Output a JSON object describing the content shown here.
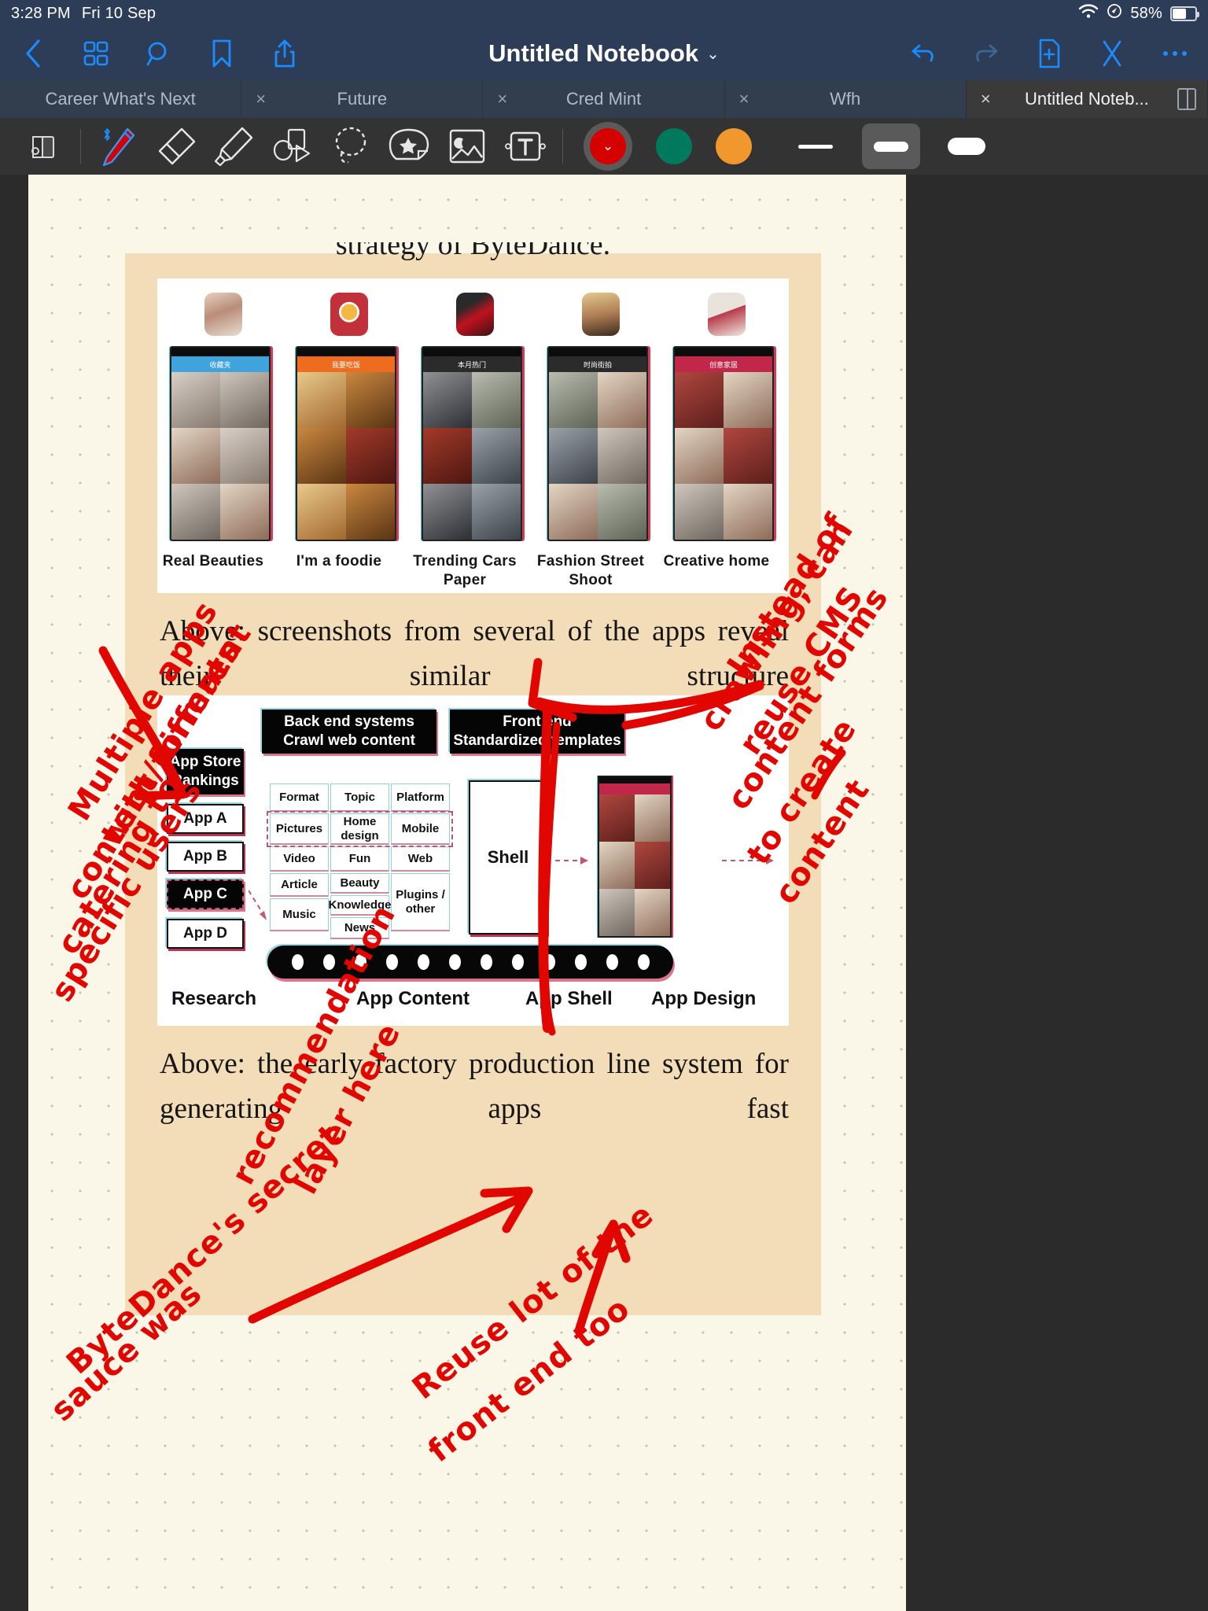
{
  "status_bar": {
    "time": "3:28 PM",
    "date": "Fri 10 Sep",
    "battery_percent": "58%",
    "wifi_icon": "wifi-icon",
    "location_icon": "location-icon"
  },
  "nav_bar": {
    "title": "Untitled Notebook",
    "title_caret": "⌄",
    "left_icons": [
      "back-chevron-icon",
      "grid-view-icon",
      "search-icon",
      "bookmark-icon",
      "share-icon"
    ],
    "right_icons": [
      "undo-icon",
      "redo-icon",
      "add-page-icon",
      "close-icon",
      "more-options-icon"
    ]
  },
  "tabs": [
    {
      "label": "Career What's Next",
      "active": false,
      "close": "×"
    },
    {
      "label": "Future",
      "active": false,
      "close": "×"
    },
    {
      "label": "Cred Mint",
      "active": false,
      "close": "×"
    },
    {
      "label": "Wfh",
      "active": false,
      "close": "×"
    },
    {
      "label": "Untitled Noteb...",
      "active": true,
      "close": "×"
    }
  ],
  "toolbar": {
    "tools": [
      {
        "name": "page-view-icon",
        "label": "Page view"
      },
      {
        "name": "pen-icon",
        "label": "Pen",
        "selected": true,
        "badge": "bluetooth-icon"
      },
      {
        "name": "eraser-icon",
        "label": "Eraser"
      },
      {
        "name": "highlighter-icon",
        "label": "Highlighter"
      },
      {
        "name": "shapes-icon",
        "label": "Shapes"
      },
      {
        "name": "lasso-select-icon",
        "label": "Lasso select"
      },
      {
        "name": "sticker-icon",
        "label": "Sticker"
      },
      {
        "name": "image-icon",
        "label": "Image"
      },
      {
        "name": "text-box-icon",
        "label": "Text box"
      }
    ],
    "colors": [
      {
        "name": "color-red-selected",
        "hex": "#d50000",
        "selected": true,
        "caret": "⌄"
      },
      {
        "name": "color-green",
        "hex": "#00795c",
        "selected": false
      },
      {
        "name": "color-orange",
        "hex": "#f0972e",
        "selected": false
      }
    ],
    "stroke_widths": [
      {
        "name": "stroke-thin",
        "selected": false
      },
      {
        "name": "stroke-medium",
        "selected": true
      },
      {
        "name": "stroke-thick",
        "selected": false
      }
    ]
  },
  "document": {
    "heading_clipped": "strategy of ByteDance.",
    "caption_1": "Above: screenshots from several of the apps reveal their similar structure",
    "caption_2": "Above: the early factory production line system for generating apps fast",
    "app_labels": [
      "Real Beauties",
      "I'm a foodie",
      "Trending Cars Paper",
      "Fashion Street Shoot",
      "Creative home"
    ],
    "phone_headers": [
      "收藏夹",
      "我要吃饭",
      "本月热门",
      "时尚街拍",
      "创意家居"
    ],
    "diagram": {
      "back_end_box": "Back end systems\nCrawl web content",
      "front_end_box": "Front end\nStandardized templates",
      "app_store_box": "App Store Rankings",
      "app_boxes": [
        "App A",
        "App B",
        "App C",
        "App D"
      ],
      "matrix_columns": [
        [
          "Format",
          "Pictures",
          "Video",
          "Article",
          "Music"
        ],
        [
          "Topic",
          "Home design",
          "Fun",
          "Beauty",
          "Knowledge",
          "News"
        ],
        [
          "Platform",
          "Mobile",
          "Web",
          "Plugins / other"
        ]
      ],
      "shell_box": "Shell",
      "bottom_labels": [
        "Research",
        "App Content",
        "App Shell",
        "App Design"
      ]
    }
  },
  "annotations": [
    {
      "name": "annotation-multiple-apps",
      "text": "Multiple apps"
    },
    {
      "name": "annotation-different-formats",
      "text": "with different"
    },
    {
      "name": "annotation-contents",
      "text": "content/formats"
    },
    {
      "name": "annotation-catering",
      "text": "catering to"
    },
    {
      "name": "annotation-specific-users",
      "text": "specific users"
    },
    {
      "name": "annotation-instead-of",
      "text": "Instead of"
    },
    {
      "name": "annotation-crawling",
      "text": "crawling, can"
    },
    {
      "name": "annotation-reuse-cms",
      "text": "reuse CMS"
    },
    {
      "name": "annotation-content-forms",
      "text": "content forms"
    },
    {
      "name": "annotation-to-create",
      "text": "to create"
    },
    {
      "name": "annotation-content",
      "text": "content"
    },
    {
      "name": "annotation-bytedance-secret",
      "text": "ByteDance's secret"
    },
    {
      "name": "annotation-sauce",
      "text": "sauce was"
    },
    {
      "name": "annotation-recommendation",
      "text": "recommendation"
    },
    {
      "name": "annotation-layer-here",
      "text": "layer here"
    },
    {
      "name": "annotation-reuse-lot-of",
      "text": "Reuse lot of the"
    },
    {
      "name": "annotation-front-end-too",
      "text": "front end too"
    }
  ]
}
